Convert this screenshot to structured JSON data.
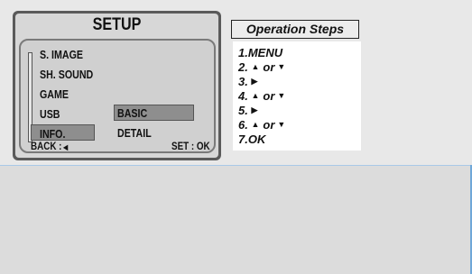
{
  "lcd": {
    "title": "SETUP",
    "menu_items": [
      "S. IMAGE",
      "SH. SOUND",
      "GAME",
      "USB",
      "INFO."
    ],
    "selected_item": "INFO.",
    "sub_items": [
      "BASIC",
      "DETAIL"
    ],
    "selected_sub_item": "BASIC",
    "footer_back": "BACK :",
    "footer_back_icon": "left-arrow",
    "footer_set": "SET : OK"
  },
  "steps": {
    "header": "Operation Steps",
    "items": [
      {
        "num": "1.",
        "text": "MENU"
      },
      {
        "num": "2.",
        "icon1": "up-arrow",
        "or": "or",
        "icon2": "down-arrow"
      },
      {
        "num": "3.",
        "icon1": "right-arrow"
      },
      {
        "num": "4.",
        "icon1": "up-arrow",
        "or": "or",
        "icon2": "down-arrow"
      },
      {
        "num": "5.",
        "icon1": "right-arrow"
      },
      {
        "num": "6.",
        "icon1": "up-arrow",
        "or": "or",
        "icon2": "down-arrow"
      },
      {
        "num": "7.",
        "text": "OK"
      }
    ]
  },
  "colors": {
    "lcd_frame": "#5a5a5a",
    "lcd_bg": "#d7d7d7",
    "highlight": "#8e8e8e",
    "accent_edge": "#6fa7d8"
  }
}
